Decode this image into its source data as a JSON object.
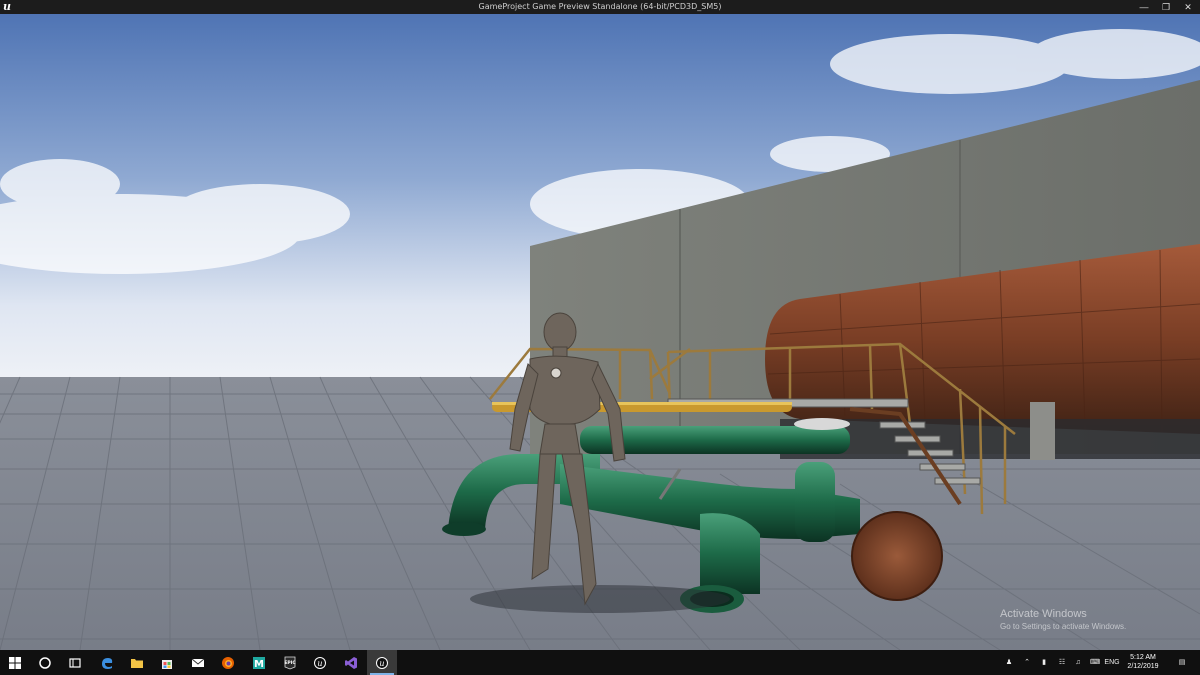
{
  "window": {
    "title": "GameProject Game Preview Standalone (64-bit/PCD3D_SM5)",
    "logo_icon": "unreal-engine-logo-icon",
    "controls": [
      "minimize-icon",
      "restore-icon",
      "close-icon"
    ]
  },
  "scene": {
    "description_icons": [
      "mannequin-character",
      "green-pipes",
      "rusty-tank",
      "concrete-wall",
      "metal-stairs",
      "grid-floor"
    ]
  },
  "watermark": {
    "title": "Activate Windows",
    "subtitle": "Go to Settings to activate Windows."
  },
  "taskbar": {
    "apps": [
      {
        "name": "start",
        "icon": "windows-start-icon"
      },
      {
        "name": "search",
        "icon": "cortana-circle-icon"
      },
      {
        "name": "task-view",
        "icon": "task-view-icon"
      },
      {
        "name": "edge",
        "icon": "edge-icon"
      },
      {
        "name": "file-explorer",
        "icon": "folder-icon"
      },
      {
        "name": "store",
        "icon": "store-bag-icon"
      },
      {
        "name": "mail",
        "icon": "mail-icon"
      },
      {
        "name": "firefox",
        "icon": "firefox-icon"
      },
      {
        "name": "maya",
        "icon": "maya-icon"
      },
      {
        "name": "epic-games",
        "icon": "epic-games-icon"
      },
      {
        "name": "unreal-editor",
        "icon": "unreal-icon"
      },
      {
        "name": "visual-studio",
        "icon": "visual-studio-icon"
      },
      {
        "name": "unreal-game",
        "icon": "unreal-icon"
      }
    ],
    "tray": {
      "language": "ENG",
      "time": "5:12 AM",
      "date": "2/12/2019"
    }
  }
}
